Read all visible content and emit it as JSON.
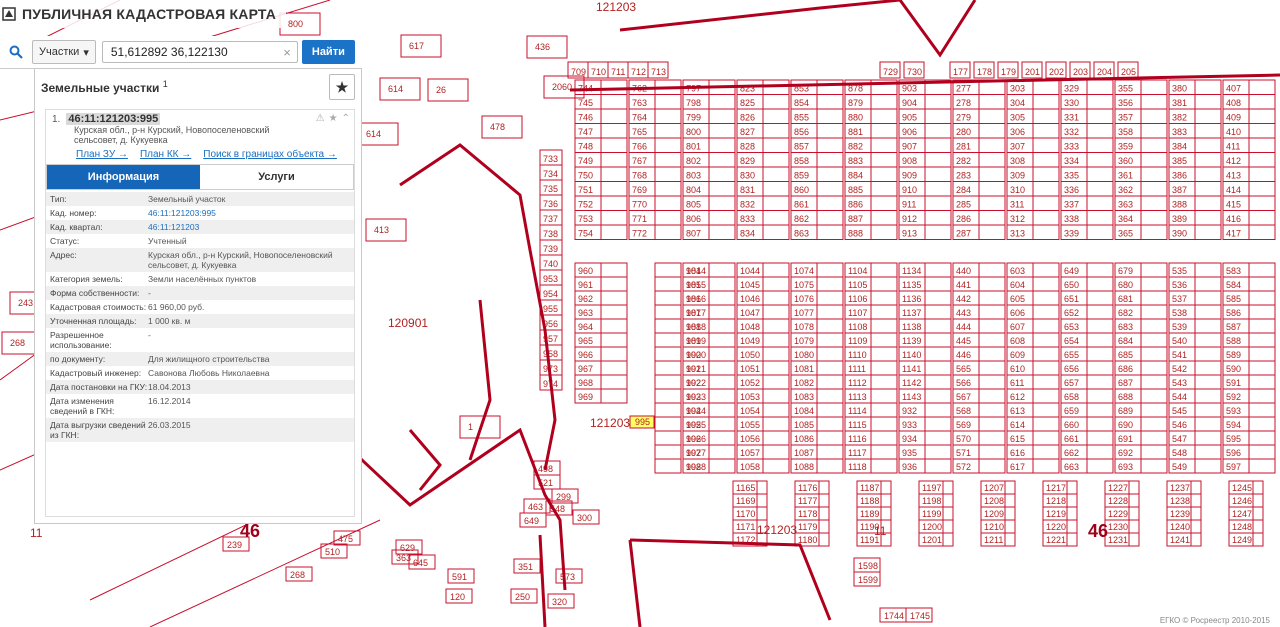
{
  "app": {
    "title": "ПУБЛИЧНАЯ КАДАСТРОВАЯ КАРТА"
  },
  "search": {
    "type_label": "Участки",
    "query": "51,612892 36,122130",
    "find_label": "Найти"
  },
  "panel": {
    "title": "Земельные участки",
    "count": "1",
    "item": {
      "index": "1.",
      "number": "46:11:121203:995",
      "address": "Курская обл., р-н Курский, Новопоселеновский сельсовет, д. Кукуевка",
      "links": [
        "План ЗУ →",
        "План КК →",
        "Поиск в границах объекта →"
      ]
    },
    "tabs": [
      "Информация",
      "Услуги"
    ],
    "rows": [
      {
        "k": "Тип:",
        "v": "Земельный участок"
      },
      {
        "k": "Кад. номер:",
        "v": "46:11:121203:995"
      },
      {
        "k": "Кад. квартал:",
        "v": "46:11:121203"
      },
      {
        "k": "Статус:",
        "v": "Учтенный"
      },
      {
        "k": "Адрес:",
        "v": "Курская обл., р-н Курский, Новопоселеновский сельсовет, д. Кукуевка"
      },
      {
        "k": "Категория земель:",
        "v": "Земли населённых пунктов"
      },
      {
        "k": "Форма собственности:",
        "v": "-"
      },
      {
        "k": "Кадастровая стоимость:",
        "v": "61 960,00 руб."
      },
      {
        "k": "Уточненная площадь:",
        "v": "1 000 кв. м"
      },
      {
        "k": "Разрешенное использование:",
        "v": "-"
      },
      {
        "k": "по документу:",
        "v": "Для жилищного строительства"
      },
      {
        "k": "Кадастровый инженер:",
        "v": "Савонова Любовь Николаевна"
      },
      {
        "k": "Дата постановки на ГКУ:",
        "v": "18.04.2013"
      },
      {
        "k": "Дата изменения сведений в ГКН:",
        "v": "16.12.2014"
      },
      {
        "k": "Дата выгрузки сведений из ГКН:",
        "v": "26.03.2015"
      }
    ]
  },
  "map_labels": {
    "quarters": [
      "121203",
      "120901",
      "121203",
      "121203"
    ],
    "districts": [
      "46",
      "11",
      "46",
      "11"
    ],
    "top_row": [
      "709",
      "710",
      "711",
      "712",
      "713",
      "729",
      "730",
      "177",
      "178",
      "179",
      "201",
      "202",
      "203",
      "204",
      "205"
    ],
    "col_a": [
      "744",
      "745",
      "746",
      "747",
      "748",
      "749",
      "750",
      "751",
      "752",
      "753",
      "754"
    ],
    "col_b": [
      "762",
      "763",
      "764",
      "765",
      "766",
      "767",
      "768",
      "769",
      "770",
      "771",
      "772"
    ],
    "col_c": [
      "797",
      "798",
      "799",
      "800",
      "801",
      "802",
      "803",
      "804",
      "805",
      "806",
      "807"
    ],
    "col_d": [
      "823",
      "825",
      "826",
      "827",
      "828",
      "829",
      "830",
      "831",
      "832",
      "833",
      "834"
    ],
    "col_e": [
      "853",
      "854",
      "855",
      "856",
      "857",
      "858",
      "859",
      "860",
      "861",
      "862",
      "863"
    ],
    "col_f": [
      "878",
      "879",
      "880",
      "881",
      "882",
      "883",
      "884",
      "885",
      "886",
      "887",
      "888"
    ],
    "col_g": [
      "903",
      "904",
      "905",
      "906",
      "907",
      "908",
      "909",
      "910",
      "911",
      "912",
      "913"
    ],
    "col_h": [
      "277",
      "278",
      "279",
      "280",
      "281",
      "282",
      "283",
      "284",
      "285",
      "286",
      "287"
    ],
    "col_i": [
      "303",
      "304",
      "305",
      "306",
      "307",
      "308",
      "309",
      "310",
      "311",
      "312",
      "313"
    ],
    "col_j": [
      "329",
      "330",
      "331",
      "332",
      "333",
      "334",
      "335",
      "336",
      "337",
      "338",
      "339"
    ],
    "col_k": [
      "355",
      "356",
      "357",
      "358",
      "359",
      "360",
      "361",
      "362",
      "363",
      "364",
      "365"
    ],
    "col_l": [
      "380",
      "381",
      "382",
      "383",
      "384",
      "385",
      "386",
      "387",
      "388",
      "389",
      "390"
    ],
    "col_m": [
      "407",
      "408",
      "409",
      "410",
      "411",
      "412",
      "413",
      "414",
      "415",
      "416",
      "417"
    ],
    "low_a": [
      "960",
      "961",
      "962",
      "963",
      "964",
      "965",
      "966",
      "967",
      "968",
      "969"
    ],
    "low_b": [
      "984",
      "985",
      "986",
      "987",
      "988",
      "989",
      "990",
      "991",
      "992",
      "993",
      "994",
      "995",
      "996",
      "997",
      "998"
    ],
    "low_c": [
      "1014",
      "1015",
      "1016",
      "1017",
      "1018",
      "1019",
      "1020",
      "1021",
      "1022",
      "1023",
      "1024",
      "1025",
      "1026",
      "1027",
      "1028"
    ],
    "low_d": [
      "1044",
      "1045",
      "1046",
      "1047",
      "1048",
      "1049",
      "1050",
      "1051",
      "1052",
      "1053",
      "1054",
      "1055",
      "1056",
      "1057",
      "1058"
    ],
    "low_e": [
      "1074",
      "1075",
      "1076",
      "1077",
      "1078",
      "1079",
      "1080",
      "1081",
      "1082",
      "1083",
      "1084",
      "1085",
      "1086",
      "1087",
      "1088"
    ],
    "low_f": [
      "1104",
      "1105",
      "1106",
      "1107",
      "1108",
      "1109",
      "1110",
      "1111",
      "1112",
      "1113",
      "1114",
      "1115",
      "1116",
      "1117",
      "1118"
    ],
    "low_g": [
      "1134",
      "1135",
      "1136",
      "1137",
      "1138",
      "1139",
      "1140",
      "1141",
      "1142",
      "1143",
      "932",
      "933",
      "934",
      "935",
      "936"
    ],
    "low_h": [
      "440",
      "441",
      "442",
      "443",
      "444",
      "445",
      "446",
      "565",
      "566",
      "567",
      "568",
      "569",
      "570",
      "571",
      "572"
    ],
    "low_i": [
      "603",
      "604",
      "605",
      "606",
      "607",
      "608",
      "609",
      "610",
      "611",
      "612",
      "613",
      "614",
      "615",
      "616",
      "617"
    ],
    "low_j": [
      "649",
      "650",
      "651",
      "652",
      "653",
      "654",
      "655",
      "656",
      "657",
      "658",
      "659",
      "660",
      "661",
      "662",
      "663"
    ],
    "low_k": [
      "679",
      "680",
      "681",
      "682",
      "683",
      "684",
      "685",
      "686",
      "687",
      "688",
      "689",
      "690",
      "691",
      "692",
      "693"
    ],
    "low_l": [
      "535",
      "536",
      "537",
      "538",
      "539",
      "540",
      "541",
      "542",
      "543",
      "544",
      "545",
      "546",
      "547",
      "548",
      "549"
    ],
    "low_m": [
      "583",
      "584",
      "585",
      "586",
      "587",
      "588",
      "589",
      "590",
      "591",
      "592",
      "593",
      "594",
      "595",
      "596",
      "597"
    ],
    "bottom_a": [
      "1165",
      "1169",
      "1170",
      "1171",
      "1172"
    ],
    "bottom_b": [
      "1176",
      "1177",
      "1178",
      "1179",
      "1180"
    ],
    "bottom_c": [
      "1187",
      "1188",
      "1189",
      "1190",
      "1191"
    ],
    "bottom_d": [
      "1197",
      "1198",
      "1199",
      "1200",
      "1201"
    ],
    "bottom_e": [
      "1207",
      "1208",
      "1209",
      "1210",
      "1211"
    ],
    "bottom_f": [
      "1217",
      "1218",
      "1219",
      "1220",
      "1221"
    ],
    "bottom_g": [
      "1227",
      "1228",
      "1229",
      "1230",
      "1231"
    ],
    "bottom_h": [
      "1237",
      "1238",
      "1239",
      "1240",
      "1241"
    ],
    "bottom_i": [
      "1245",
      "1246",
      "1247",
      "1248",
      "1249"
    ],
    "left_misc": [
      "800",
      "617",
      "614",
      "26",
      "413",
      "243",
      "268",
      "614",
      "436",
      "2060",
      "478",
      "1"
    ],
    "side_left": [
      "733",
      "734",
      "735",
      "736",
      "737",
      "738",
      "739",
      "740",
      "953",
      "954",
      "955",
      "956",
      "957",
      "958",
      "973",
      "974"
    ],
    "bottom_misc": [
      "498",
      "521",
      "299",
      "463",
      "548",
      "649",
      "300",
      "591",
      "573",
      "120",
      "250",
      "351",
      "239",
      "629",
      "645",
      "268",
      "363",
      "475",
      "510",
      "320",
      "1598",
      "1599",
      "1744",
      "1745"
    ]
  },
  "footer": {
    "copyright": "ЕГКО © Росреестр 2010-2015"
  }
}
